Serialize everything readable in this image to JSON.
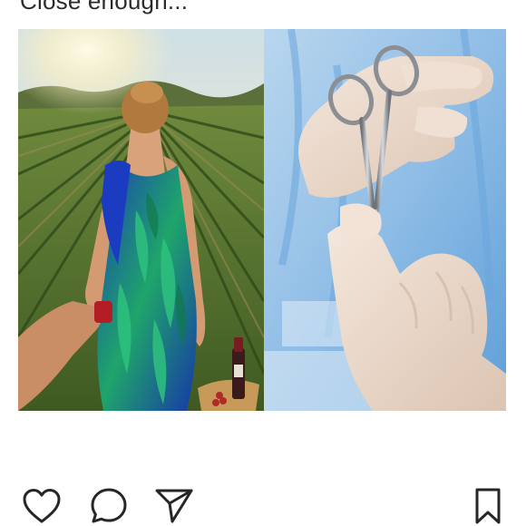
{
  "post": {
    "caption": "Close enough...",
    "images": [
      {
        "name": "woman-in-vineyard-photo"
      },
      {
        "name": "surgeon-holding-forceps-photo"
      }
    ]
  },
  "actions": {
    "like_icon": "heart-outline",
    "comment_icon": "speech-bubble-outline",
    "share_icon": "paper-plane-outline",
    "save_icon": "bookmark-outline"
  },
  "colors": {
    "icon": "#262626",
    "text": "#2b2b2b",
    "background": "#ffffff"
  }
}
